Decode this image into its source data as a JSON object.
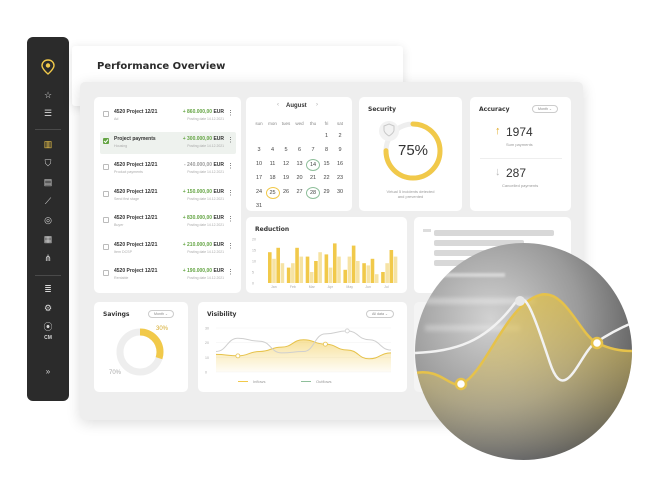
{
  "page_title": "Performance Overview",
  "sidebar": {
    "icons": [
      "logo-icon",
      "star-icon",
      "list-icon",
      "book-icon",
      "shield-icon",
      "document-icon",
      "chart-icon",
      "coins-icon",
      "calculator-icon",
      "share-icon",
      "database-icon",
      "gear-icon",
      "location-icon"
    ],
    "user_initials": "CM",
    "expand_label": "»"
  },
  "projects": [
    {
      "title": "4520 Project 12/21",
      "sub": "Ad",
      "sign": "+",
      "amount": "860.000,00",
      "currency": "EUR",
      "date": "Posting date 14.12.2021",
      "checked": false
    },
    {
      "title": "Project payments",
      "sub": "Housing",
      "sign": "+",
      "amount": "300.000,00",
      "currency": "EUR",
      "date": "Posting date 14.12.2021",
      "checked": true
    },
    {
      "title": "4520 Project 12/21",
      "sub": "Product payments",
      "sign": "-",
      "amount": "240.000,00",
      "currency": "EUR",
      "date": "Posting date 14.12.2021",
      "checked": false
    },
    {
      "title": "4520 Project 12/21",
      "sub": "Send first stage",
      "sign": "+",
      "amount": "150.000,00",
      "currency": "EUR",
      "date": "Posting date 14.12.2021",
      "checked": false
    },
    {
      "title": "4520 Project 12/21",
      "sub": "Buyer",
      "sign": "+",
      "amount": "830.000,00",
      "currency": "EUR",
      "date": "Posting date 14.12.2021",
      "checked": false
    },
    {
      "title": "4520 Project 12/21",
      "sub": "Item DCSP",
      "sign": "+",
      "amount": "210.000,00",
      "currency": "EUR",
      "date": "Posting date 14.12.2021",
      "checked": false
    },
    {
      "title": "4520 Project 12/21",
      "sub": "Rentable",
      "sign": "+",
      "amount": "190.000,00",
      "currency": "EUR",
      "date": "Posting date 14.12.2021",
      "checked": false
    }
  ],
  "calendar": {
    "month": "August",
    "weekdays": [
      "sun",
      "mon",
      "tues",
      "wed",
      "thu",
      "fri",
      "sat"
    ],
    "rows": [
      [
        "",
        "",
        "",
        "",
        "",
        "1",
        "2"
      ],
      [
        "3",
        "4",
        "5",
        "6",
        "7",
        "8",
        "9"
      ],
      [
        "10",
        "11",
        "12",
        "13",
        "14",
        "15",
        "16"
      ],
      [
        "17",
        "18",
        "19",
        "20",
        "21",
        "22",
        "23"
      ],
      [
        "24",
        "25",
        "26",
        "27",
        "28",
        "29",
        "30"
      ],
      [
        "31",
        "",
        "",
        "",
        "",
        "",
        ""
      ]
    ],
    "highlight_yellow": [
      "25"
    ],
    "highlight_green": [
      "14",
      "28"
    ]
  },
  "security": {
    "title": "Security",
    "percent": "75%",
    "value": 0.75,
    "note_line1": "Virtual 5 incidents detected",
    "note_line2": "and prevented"
  },
  "accuracy": {
    "title": "Accuracy",
    "filter": "Month",
    "up_value": "1974",
    "up_label": "Sum payments",
    "down_value": "287",
    "down_label": "Cancelled payments"
  },
  "reduction": {
    "title": "Reduction"
  },
  "savings": {
    "title": "Savings",
    "filter": "Month",
    "pct_top": "30%",
    "pct_bottom": "70%",
    "value": 0.3
  },
  "visibility": {
    "title": "Visibility",
    "filter": "All data",
    "legend1": "Inflows",
    "legend2": "Outflows"
  },
  "colors": {
    "accent": "#f1c94a",
    "accent_light": "#f6e3a4",
    "green": "#63a442",
    "sidebar": "#2b2b2b"
  },
  "chart_data": [
    {
      "type": "bar",
      "title": "Reduction",
      "categories": [
        "Jan",
        "Feb",
        "Mar",
        "Apr",
        "May",
        "Jun",
        "Jul"
      ],
      "series": [
        {
          "values": [
            14,
            7,
            12,
            13,
            6,
            9,
            5
          ]
        },
        {
          "values": [
            11,
            9,
            5,
            7,
            12,
            8,
            9
          ]
        },
        {
          "values": [
            16,
            16,
            10,
            18,
            17,
            11,
            15
          ]
        },
        {
          "values": [
            9,
            12,
            14,
            12,
            10,
            4,
            12
          ]
        }
      ],
      "ylim": [
        0,
        20
      ],
      "ytick_labels": [
        "20",
        "15",
        "10",
        "5",
        "0"
      ]
    },
    {
      "type": "area",
      "title": "Visibility",
      "x": [
        0,
        1,
        2,
        3,
        4,
        5,
        6,
        7,
        8
      ],
      "series": [
        {
          "name": "Inflows",
          "values": [
            12,
            11,
            14,
            17,
            22,
            19,
            15,
            9,
            13
          ]
        },
        {
          "name": "Outflows",
          "values": [
            14,
            23,
            21,
            13,
            14,
            26,
            28,
            22,
            15
          ]
        }
      ],
      "ylim": [
        0,
        30
      ],
      "ytick_labels": [
        "30",
        "20",
        "10",
        "0"
      ]
    }
  ]
}
